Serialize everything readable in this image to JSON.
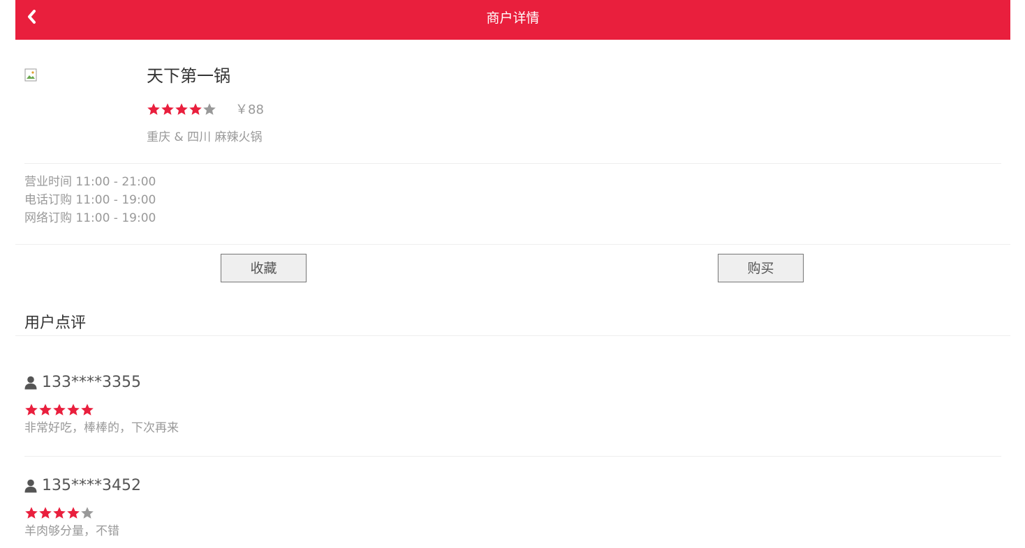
{
  "header": {
    "title": "商户详情",
    "back_icon": "chevron-left-icon"
  },
  "shop": {
    "image_alt": "",
    "name": "天下第一锅",
    "rating": 4,
    "rating_max": 5,
    "price": "￥88",
    "category": "重庆 & 四川 麻辣火锅"
  },
  "hours": {
    "business": "营业时间 11:00 - 21:00",
    "phone_order": "电话订购 11:00 - 19:00",
    "online_order": "网络订购 11:00 - 19:00"
  },
  "actions": {
    "favorite_label": "收藏",
    "buy_label": "购买"
  },
  "reviews_section": {
    "title": "用户点评",
    "items": [
      {
        "user_icon": "user-icon",
        "user": "133****3355",
        "rating": 5,
        "comment": "非常好吃，棒棒的，下次再来"
      },
      {
        "user_icon": "user-icon",
        "user": "135****3452",
        "rating": 4,
        "comment": "羊肉够分量，不错"
      }
    ]
  },
  "colors": {
    "brand": "#e91f3d",
    "star_on": "#e91f3d",
    "star_off": "#999999",
    "muted_text": "#999999"
  }
}
